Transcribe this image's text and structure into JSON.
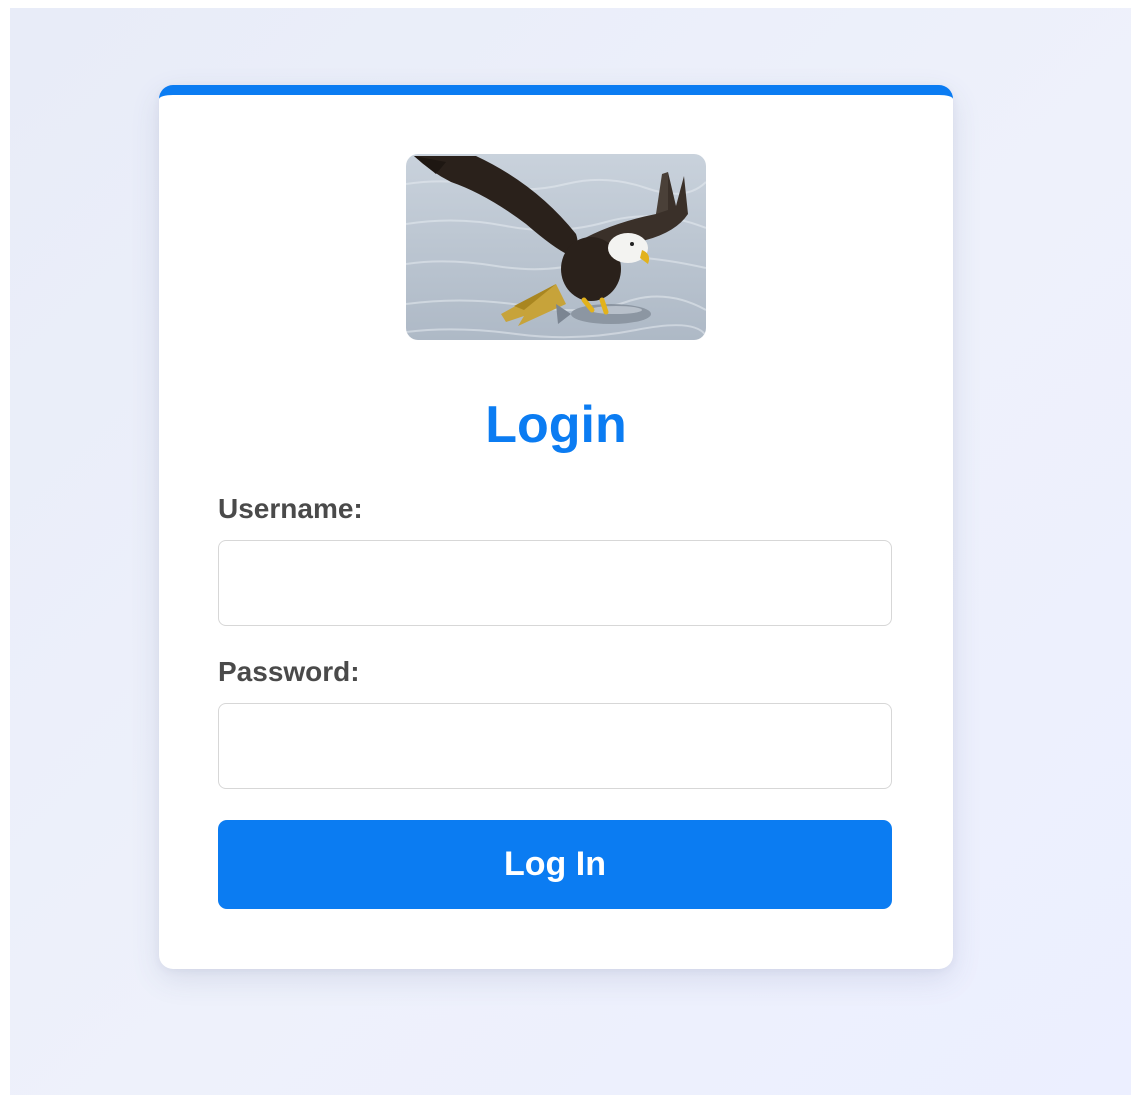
{
  "login": {
    "title": "Login",
    "username_label": "Username:",
    "username_value": "",
    "password_label": "Password:",
    "password_value": "",
    "submit_label": "Log In"
  },
  "image": {
    "subject": "bald-eagle-catching-fish"
  },
  "colors": {
    "accent": "#0b7cf2",
    "background": "#eceffa",
    "label_text": "#4a4a4a",
    "field_border": "#d7d7d7"
  }
}
